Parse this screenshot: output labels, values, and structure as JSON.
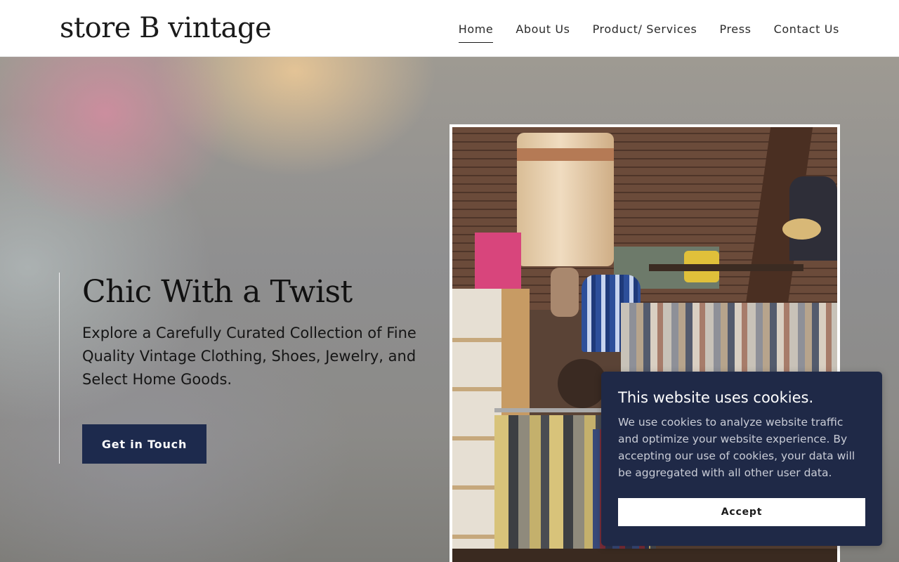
{
  "site": {
    "logo": "store B vintage"
  },
  "nav": {
    "items": [
      {
        "label": "Home",
        "active": true
      },
      {
        "label": "About Us",
        "active": false
      },
      {
        "label": "Product/ Services",
        "active": false
      },
      {
        "label": "Press",
        "active": false
      },
      {
        "label": "Contact Us",
        "active": false
      }
    ]
  },
  "hero": {
    "title": "Chic With a Twist",
    "subtitle": "Explore a Carefully Curated Collection of Fine Quality Vintage Clothing, Shoes, Jewelry, and Select Home Goods.",
    "cta_label": "Get in Touch"
  },
  "cookie_banner": {
    "title": "This website uses cookies.",
    "body": "We use cookies to analyze website traffic and optimize your website experience. By accepting our use of cookies, your data will be aggregated with all other user data.",
    "accept_label": "Accept"
  },
  "colors": {
    "button_bg": "#1d2a4d",
    "cookie_bg": "#1f2947",
    "text": "#1b1b1b"
  }
}
